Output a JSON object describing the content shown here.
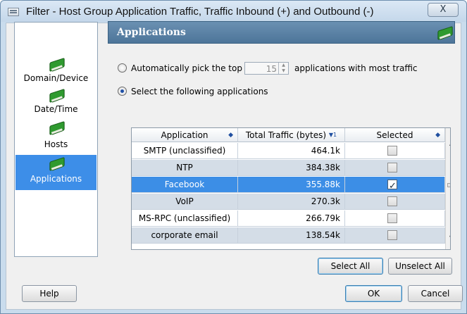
{
  "window": {
    "title": "Filter - Host Group Application Traffic, Traffic Inbound (+) and Outbound (-)",
    "close_glyph": "X"
  },
  "nav": {
    "items": [
      {
        "label": "Domain/Device",
        "icon": "book-icon",
        "active": false
      },
      {
        "label": "Date/Time",
        "icon": "book-icon",
        "active": false
      },
      {
        "label": "Hosts",
        "icon": "book-icon",
        "active": false
      },
      {
        "label": "Applications",
        "icon": "book-icon",
        "active": true
      }
    ]
  },
  "section": {
    "title": "Applications",
    "icon": "book-icon"
  },
  "options": {
    "auto_label": "Automatically pick the top",
    "top_n_value": "15",
    "auto_suffix": "applications with most traffic",
    "manual_label": "Select the following applications",
    "selected_option": "manual"
  },
  "table": {
    "columns": {
      "application": "Application",
      "traffic": "Total Traffic (bytes)",
      "traffic_sort_badge": "▼1",
      "selected": "Selected"
    },
    "rows": [
      {
        "application": "SMTP (unclassified)",
        "traffic": "464.1k",
        "selected": false
      },
      {
        "application": "NTP",
        "traffic": "384.38k",
        "selected": false
      },
      {
        "application": "Facebook",
        "traffic": "355.88k",
        "selected": true
      },
      {
        "application": "VoIP",
        "traffic": "270.3k",
        "selected": false
      },
      {
        "application": "MS-RPC (unclassified)",
        "traffic": "266.79k",
        "selected": false
      },
      {
        "application": "corporate email",
        "traffic": "138.54k",
        "selected": false
      }
    ]
  },
  "buttons": {
    "select_all": "Select All",
    "unselect_all": "Unselect All",
    "help": "Help",
    "ok": "OK",
    "cancel": "Cancel"
  },
  "colors": {
    "selection_blue": "#3c8ee6",
    "header_blue": "#5a81a5",
    "icon_green": "#2f9a2f"
  }
}
